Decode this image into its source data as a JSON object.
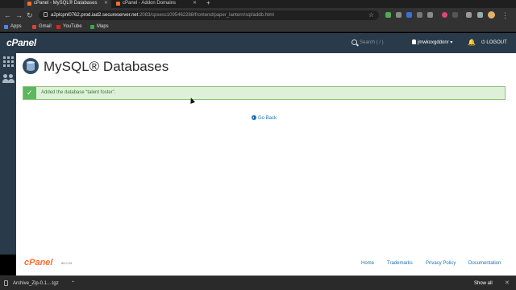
{
  "browser": {
    "tabs": [
      {
        "title": "cPanel - MySQL® Databases",
        "active": true
      },
      {
        "title": "cPanel - Addon Domains",
        "active": false
      }
    ],
    "new_tab": "+",
    "url_host": "a2plcpnl0762.prod.iad2.secureserver.net",
    "url_path": ":2083/cpsess1095462288/frontend/paper_lantern/sql/addb.html",
    "bookmarks": [
      "Apps",
      "Gmail",
      "YouTube",
      "Maps"
    ]
  },
  "cpanel": {
    "logo": "cPanel",
    "search_placeholder": "Search ( / )",
    "username": "jmwkoxgddonr",
    "logout": "LOGOUT"
  },
  "main": {
    "page_title": "MySQL® Databases",
    "alert_message": "Added the database “talent foster”.",
    "go_back": "Go Back"
  },
  "footer": {
    "logo": "cPanel",
    "version": "86.0.25",
    "links": [
      "Home",
      "Trademarks",
      "Privacy Policy",
      "Documentation"
    ]
  },
  "downloads": {
    "file": "Archive_Zip-0.1....tgz",
    "show_all": "Show all"
  },
  "colors": {
    "cpanel_header": "#293a4a",
    "alert_bg": "#dff0d8",
    "alert_ok": "#5cb85c",
    "link": "#1b72b8",
    "brand_orange": "#ff6c2c"
  }
}
